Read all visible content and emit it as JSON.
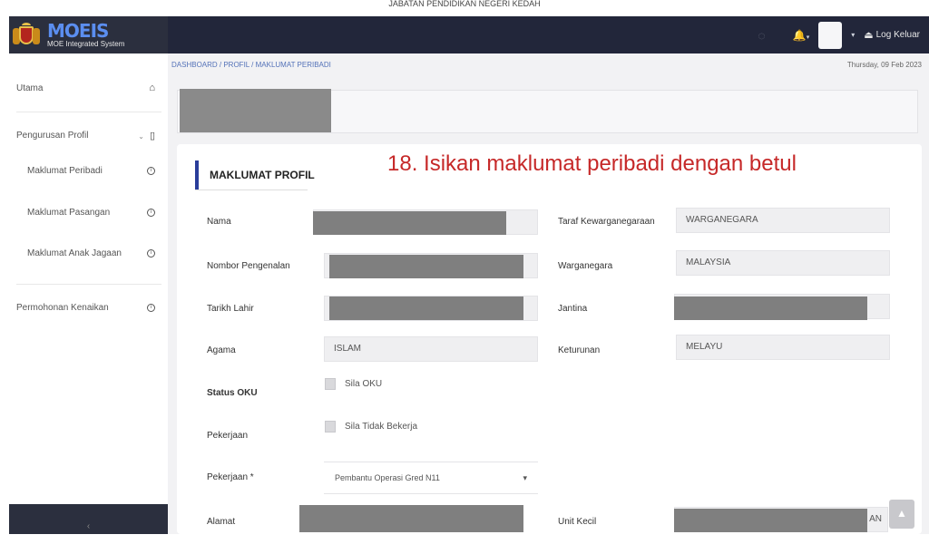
{
  "caption": "JABATAN PENDIDIKAN NEGERI KEDAH",
  "header": {
    "brand_title": "MOEIS",
    "brand_subtitle": "MOE Integrated System",
    "logout_label": "Log Keluar",
    "bell_caret": "▾",
    "user_caret": "▾"
  },
  "sidebar": {
    "items": [
      {
        "label": "Utama",
        "icon": "home-icon",
        "glyph": "⌂"
      },
      {
        "label": "Pengurusan Profil",
        "icon": "document-icon",
        "glyph": "▯"
      },
      {
        "label": "Maklumat Peribadi",
        "icon": "info-icon",
        "glyph": "i"
      },
      {
        "label": "Maklumat Pasangan",
        "icon": "info-icon",
        "glyph": "i"
      },
      {
        "label": "Maklumat Anak Jagaan",
        "icon": "info-icon",
        "glyph": "i"
      },
      {
        "label": "Permohonan Kenaikan",
        "icon": "info-icon",
        "glyph": "i"
      }
    ],
    "collapse_glyph": "‹"
  },
  "breadcrumb": "DASHBOARD / PROFIL / MAKLUMAT PERIBADI",
  "date": "Thursday, 09 Feb 2023",
  "card": {
    "heading": "MAKLUMAT PROFIL",
    "annotation": "18. Isikan maklumat peribadi dengan betul",
    "labels": {
      "nama": "Nama",
      "nombor_pengenalan": "Nombor Pengenalan",
      "tarikh_lahir": "Tarikh Lahir",
      "agama": "Agama",
      "status_oku": "Status OKU",
      "pekerjaan_status": "Pekerjaan",
      "pekerjaan": "Pekerjaan *",
      "alamat": "Alamat",
      "taraf_kewarganegaraan": "Taraf Kewarganegaraan",
      "warganegara": "Warganegara",
      "jantina": "Jantina",
      "keturunan": "Keturunan",
      "unit_kecil": "Unit Kecil"
    },
    "values": {
      "agama": "ISLAM",
      "taraf_kewarganegaraan": "WARGANEGARA",
      "warganegara": "MALAYSIA",
      "keturunan": "MELAYU",
      "unit_kecil_suffix": "AN"
    },
    "checkbox_oku": "Sila OKU",
    "checkbox_bekerja": "Sila Tidak Bekerja",
    "pekerjaan_select": "Pembantu Operasi Gred N11",
    "select_caret": "▾"
  },
  "scroll_top_glyph": "▲"
}
